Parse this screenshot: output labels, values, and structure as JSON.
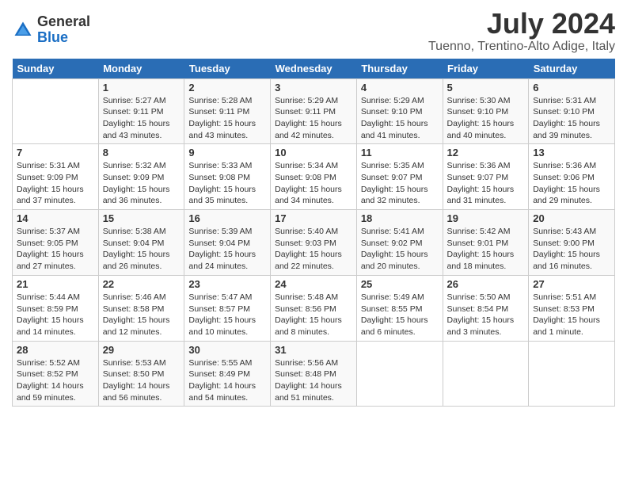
{
  "logo": {
    "general": "General",
    "blue": "Blue"
  },
  "title": {
    "month_year": "July 2024",
    "location": "Tuenno, Trentino-Alto Adige, Italy"
  },
  "days_of_week": [
    "Sunday",
    "Monday",
    "Tuesday",
    "Wednesday",
    "Thursday",
    "Friday",
    "Saturday"
  ],
  "weeks": [
    [
      {
        "day": "",
        "info": ""
      },
      {
        "day": "1",
        "info": "Sunrise: 5:27 AM\nSunset: 9:11 PM\nDaylight: 15 hours\nand 43 minutes."
      },
      {
        "day": "2",
        "info": "Sunrise: 5:28 AM\nSunset: 9:11 PM\nDaylight: 15 hours\nand 43 minutes."
      },
      {
        "day": "3",
        "info": "Sunrise: 5:29 AM\nSunset: 9:11 PM\nDaylight: 15 hours\nand 42 minutes."
      },
      {
        "day": "4",
        "info": "Sunrise: 5:29 AM\nSunset: 9:10 PM\nDaylight: 15 hours\nand 41 minutes."
      },
      {
        "day": "5",
        "info": "Sunrise: 5:30 AM\nSunset: 9:10 PM\nDaylight: 15 hours\nand 40 minutes."
      },
      {
        "day": "6",
        "info": "Sunrise: 5:31 AM\nSunset: 9:10 PM\nDaylight: 15 hours\nand 39 minutes."
      }
    ],
    [
      {
        "day": "7",
        "info": "Sunrise: 5:31 AM\nSunset: 9:09 PM\nDaylight: 15 hours\nand 37 minutes."
      },
      {
        "day": "8",
        "info": "Sunrise: 5:32 AM\nSunset: 9:09 PM\nDaylight: 15 hours\nand 36 minutes."
      },
      {
        "day": "9",
        "info": "Sunrise: 5:33 AM\nSunset: 9:08 PM\nDaylight: 15 hours\nand 35 minutes."
      },
      {
        "day": "10",
        "info": "Sunrise: 5:34 AM\nSunset: 9:08 PM\nDaylight: 15 hours\nand 34 minutes."
      },
      {
        "day": "11",
        "info": "Sunrise: 5:35 AM\nSunset: 9:07 PM\nDaylight: 15 hours\nand 32 minutes."
      },
      {
        "day": "12",
        "info": "Sunrise: 5:36 AM\nSunset: 9:07 PM\nDaylight: 15 hours\nand 31 minutes."
      },
      {
        "day": "13",
        "info": "Sunrise: 5:36 AM\nSunset: 9:06 PM\nDaylight: 15 hours\nand 29 minutes."
      }
    ],
    [
      {
        "day": "14",
        "info": "Sunrise: 5:37 AM\nSunset: 9:05 PM\nDaylight: 15 hours\nand 27 minutes."
      },
      {
        "day": "15",
        "info": "Sunrise: 5:38 AM\nSunset: 9:04 PM\nDaylight: 15 hours\nand 26 minutes."
      },
      {
        "day": "16",
        "info": "Sunrise: 5:39 AM\nSunset: 9:04 PM\nDaylight: 15 hours\nand 24 minutes."
      },
      {
        "day": "17",
        "info": "Sunrise: 5:40 AM\nSunset: 9:03 PM\nDaylight: 15 hours\nand 22 minutes."
      },
      {
        "day": "18",
        "info": "Sunrise: 5:41 AM\nSunset: 9:02 PM\nDaylight: 15 hours\nand 20 minutes."
      },
      {
        "day": "19",
        "info": "Sunrise: 5:42 AM\nSunset: 9:01 PM\nDaylight: 15 hours\nand 18 minutes."
      },
      {
        "day": "20",
        "info": "Sunrise: 5:43 AM\nSunset: 9:00 PM\nDaylight: 15 hours\nand 16 minutes."
      }
    ],
    [
      {
        "day": "21",
        "info": "Sunrise: 5:44 AM\nSunset: 8:59 PM\nDaylight: 15 hours\nand 14 minutes."
      },
      {
        "day": "22",
        "info": "Sunrise: 5:46 AM\nSunset: 8:58 PM\nDaylight: 15 hours\nand 12 minutes."
      },
      {
        "day": "23",
        "info": "Sunrise: 5:47 AM\nSunset: 8:57 PM\nDaylight: 15 hours\nand 10 minutes."
      },
      {
        "day": "24",
        "info": "Sunrise: 5:48 AM\nSunset: 8:56 PM\nDaylight: 15 hours\nand 8 minutes."
      },
      {
        "day": "25",
        "info": "Sunrise: 5:49 AM\nSunset: 8:55 PM\nDaylight: 15 hours\nand 6 minutes."
      },
      {
        "day": "26",
        "info": "Sunrise: 5:50 AM\nSunset: 8:54 PM\nDaylight: 15 hours\nand 3 minutes."
      },
      {
        "day": "27",
        "info": "Sunrise: 5:51 AM\nSunset: 8:53 PM\nDaylight: 15 hours\nand 1 minute."
      }
    ],
    [
      {
        "day": "28",
        "info": "Sunrise: 5:52 AM\nSunset: 8:52 PM\nDaylight: 14 hours\nand 59 minutes."
      },
      {
        "day": "29",
        "info": "Sunrise: 5:53 AM\nSunset: 8:50 PM\nDaylight: 14 hours\nand 56 minutes."
      },
      {
        "day": "30",
        "info": "Sunrise: 5:55 AM\nSunset: 8:49 PM\nDaylight: 14 hours\nand 54 minutes."
      },
      {
        "day": "31",
        "info": "Sunrise: 5:56 AM\nSunset: 8:48 PM\nDaylight: 14 hours\nand 51 minutes."
      },
      {
        "day": "",
        "info": ""
      },
      {
        "day": "",
        "info": ""
      },
      {
        "day": "",
        "info": ""
      }
    ]
  ]
}
